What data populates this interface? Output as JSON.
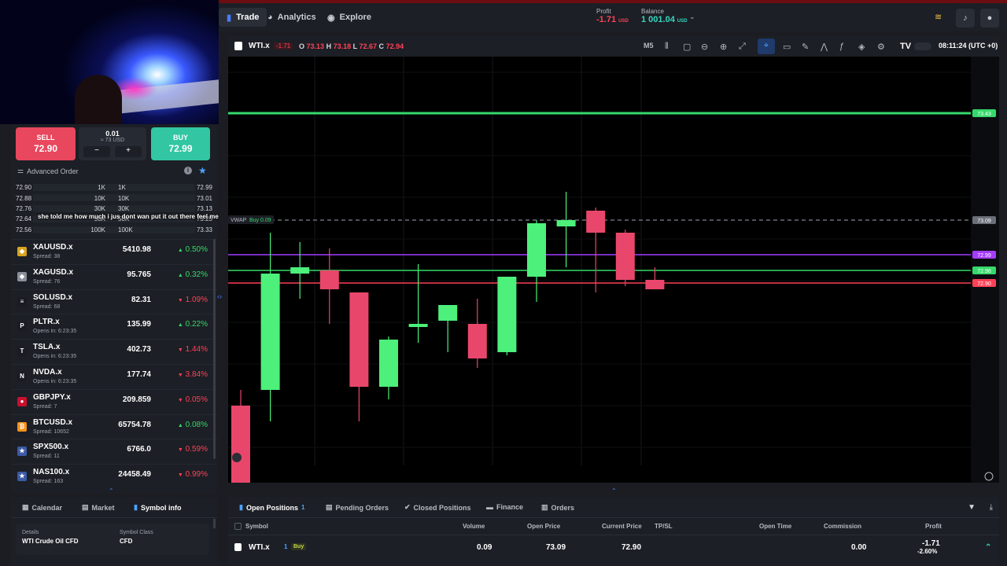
{
  "colors": {
    "up": "#35d96b",
    "down": "#ff4157",
    "sell": "#e8475d",
    "buy": "#32c6a3",
    "accent": "#4b7cff",
    "panel": "#1c1f25"
  },
  "topnav": {
    "tabs": [
      {
        "label": "Trade",
        "icon": "candlestick-icon"
      },
      {
        "label": "Analytics",
        "icon": "pie-chart-icon"
      },
      {
        "label": "Explore",
        "icon": "compass-icon"
      }
    ],
    "profit_label": "Profit",
    "profit_value": "-1.71",
    "profit_unit": "USD",
    "balance_label": "Balance",
    "balance_value": "1 001.04",
    "balance_unit": "USD"
  },
  "order": {
    "sell_label": "SELL",
    "sell_price": "72.90",
    "buy_label": "BUY",
    "buy_price": "72.99",
    "quantity": "0.01",
    "quantity_usd": "≈ 73 USD",
    "minus": "−",
    "plus": "+",
    "advanced_label": "Advanced Order"
  },
  "depth": {
    "rows": [
      {
        "bid": "72.90",
        "bid_vol": "1K",
        "ask_vol": "1K",
        "ask": "72.99"
      },
      {
        "bid": "72.88",
        "bid_vol": "10K",
        "ask_vol": "10K",
        "ask": "73.01"
      },
      {
        "bid": "72.76",
        "bid_vol": "30K",
        "ask_vol": "30K",
        "ask": "73.13"
      },
      {
        "bid": "72.64",
        "bid_vol": "50K",
        "ask_vol": "50K",
        "ask": "73.25"
      },
      {
        "bid": "72.56",
        "bid_vol": "100K",
        "ask_vol": "100K",
        "ask": "73.33"
      }
    ]
  },
  "caption": "she told me how much i jus dont wan put it out there feel me",
  "symbols": [
    {
      "name": "XAUUSD.x",
      "sub": "Spread: 38",
      "price": "5410.98",
      "change": "0.50%",
      "dir": "up",
      "logo": "gold-icon",
      "logo_color": "#d8a31f",
      "glyph": "◆"
    },
    {
      "name": "XAGUSD.x",
      "sub": "Spread: 76",
      "price": "95.765",
      "change": "0.32%",
      "dir": "up",
      "logo": "silver-icon",
      "logo_color": "#8b8f99",
      "glyph": "◆"
    },
    {
      "name": "SOLUSD.x",
      "sub": "Spread: 68",
      "price": "82.31",
      "change": "1.09%",
      "dir": "down",
      "logo": "solana-icon",
      "logo_color": "#1a1c22",
      "glyph": "≡"
    },
    {
      "name": "PLTR.x",
      "sub": "Opens in: 6:23:35",
      "price": "135.99",
      "change": "0.22%",
      "dir": "up",
      "logo": "palantir-icon",
      "logo_color": "#1a1c22",
      "glyph": "P"
    },
    {
      "name": "TSLA.x",
      "sub": "Opens in: 6:23:35",
      "price": "402.73",
      "change": "1.44%",
      "dir": "down",
      "logo": "tesla-icon",
      "logo_color": "#1a1c22",
      "glyph": "T"
    },
    {
      "name": "NVDA.x",
      "sub": "Opens in: 6:23:35",
      "price": "177.74",
      "change": "3.84%",
      "dir": "down",
      "logo": "nvidia-icon",
      "logo_color": "#1a1c22",
      "glyph": "N"
    },
    {
      "name": "GBPJPY.x",
      "sub": "Spread: 7",
      "price": "209.859",
      "change": "0.05%",
      "dir": "down",
      "logo": "flag-icon",
      "logo_color": "#c8102e",
      "glyph": "●"
    },
    {
      "name": "BTCUSD.x",
      "sub": "Spread: 10652",
      "price": "65754.78",
      "change": "0.08%",
      "dir": "up",
      "logo": "bitcoin-icon",
      "logo_color": "#f7931a",
      "glyph": "₿"
    },
    {
      "name": "SPX500.x",
      "sub": "Spread: 11",
      "price": "6766.0",
      "change": "0.59%",
      "dir": "down",
      "logo": "us-flag-icon",
      "logo_color": "#3c5aa6",
      "glyph": "★"
    },
    {
      "name": "NAS100.x",
      "sub": "Spread: 163",
      "price": "24458.49",
      "change": "0.99%",
      "dir": "down",
      "logo": "us-flag-icon",
      "logo_color": "#3c5aa6",
      "glyph": "★"
    }
  ],
  "chart_header": {
    "symbol": "WTI.x",
    "change": "-1.71",
    "o_label": "O",
    "o": "73.13",
    "h_label": "H",
    "h": "73.18",
    "l_label": "L",
    "l": "72.67",
    "c_label": "C",
    "c": "72.94",
    "timeframe": "M5",
    "clock": "08:11:24 (UTC +0)"
  },
  "chart_data": {
    "type": "candlestick",
    "candles": [
      {
        "o": 72.5,
        "h": 72.55,
        "l": 72.2,
        "c": 72.2
      },
      {
        "o": 72.55,
        "h": 73.05,
        "l": 72.45,
        "c": 72.92
      },
      {
        "o": 72.92,
        "h": 73.02,
        "l": 72.84,
        "c": 72.94
      },
      {
        "o": 72.93,
        "h": 73.0,
        "l": 72.76,
        "c": 72.87
      },
      {
        "o": 72.86,
        "h": 72.86,
        "l": 72.45,
        "c": 72.56
      },
      {
        "o": 72.56,
        "h": 72.72,
        "l": 72.52,
        "c": 72.71
      },
      {
        "o": 72.75,
        "h": 72.95,
        "l": 72.7,
        "c": 72.76
      },
      {
        "o": 72.77,
        "h": 72.82,
        "l": 72.67,
        "c": 72.82
      },
      {
        "o": 72.76,
        "h": 72.84,
        "l": 72.62,
        "c": 72.65
      },
      {
        "o": 72.67,
        "h": 72.91,
        "l": 72.66,
        "c": 72.91
      },
      {
        "o": 72.91,
        "h": 73.09,
        "l": 72.83,
        "c": 73.08
      },
      {
        "o": 73.07,
        "h": 73.18,
        "l": 72.94,
        "c": 73.09
      },
      {
        "o": 73.12,
        "h": 73.13,
        "l": 72.86,
        "c": 73.05
      },
      {
        "o": 73.05,
        "h": 73.06,
        "l": 72.88,
        "c": 72.9
      },
      {
        "o": 72.9,
        "h": 72.94,
        "l": 72.87,
        "c": 72.87
      }
    ],
    "ylim": [
      72.3,
      73.6
    ],
    "lines": [
      {
        "label": "73.43",
        "value": 73.43,
        "color": "#35d96b"
      },
      {
        "label": "73.09",
        "value": 73.09,
        "color": "#6b6f78",
        "dashed": true
      },
      {
        "label": "72.99",
        "value": 72.98,
        "color": "#a33cff"
      },
      {
        "label": "72.96",
        "value": 72.93,
        "color": "#35d96b"
      },
      {
        "label": "72.90",
        "value": 72.89,
        "color": "#ff4157"
      }
    ],
    "vwap_label": "VWAP",
    "position_tag": "Buy 0.09"
  },
  "bottom_left": {
    "tabs": [
      {
        "label": "Calendar",
        "icon": "calendar-icon"
      },
      {
        "label": "Market",
        "icon": "market-icon"
      },
      {
        "label": "Symbol info",
        "icon": "info-icon"
      }
    ],
    "details_label": "Details",
    "details_value": "WTI Crude Oil CFD",
    "class_label": "Symbol Class",
    "class_value": "CFD"
  },
  "positions": {
    "tabs": [
      {
        "label": "Open Positions",
        "count": "1",
        "icon": "chart-bar-icon"
      },
      {
        "label": "Pending Orders",
        "icon": "document-icon"
      },
      {
        "label": "Closed Positions",
        "icon": "check-circle-icon"
      },
      {
        "label": "Finance",
        "icon": "wallet-icon"
      },
      {
        "label": "Orders",
        "icon": "orders-icon"
      }
    ],
    "columns": [
      "Symbol",
      "Volume",
      "Open Price",
      "Current Price",
      "TP/SL",
      "Open Time",
      "Commission",
      "Profit"
    ],
    "row": {
      "symbol": "WTI.x",
      "count": "1",
      "side": "Buy",
      "volume": "0.09",
      "open_price": "73.09",
      "current_price": "72.90",
      "commission": "0.00",
      "profit": "-1.71",
      "profit_pct": "-2.60%"
    }
  }
}
